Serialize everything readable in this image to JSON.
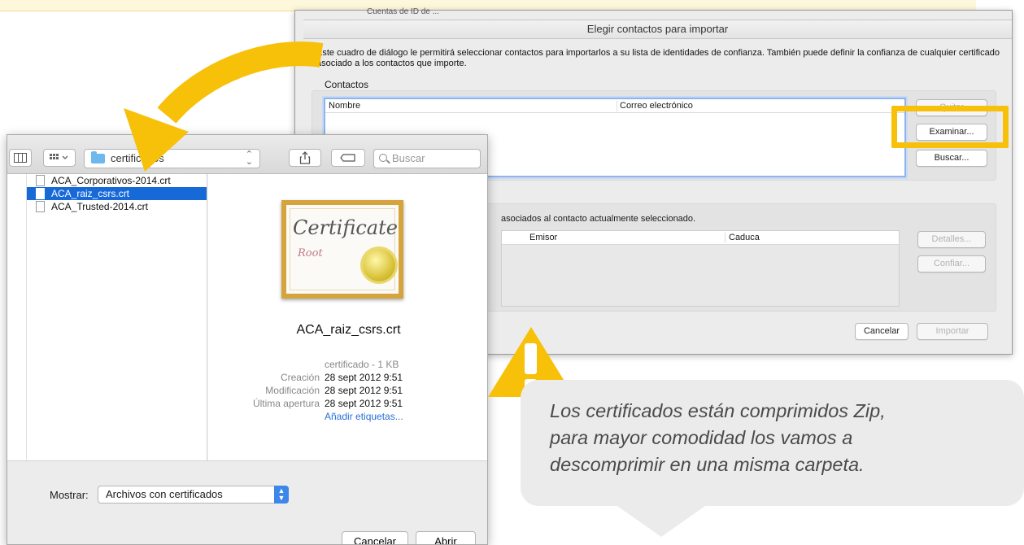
{
  "back_dialog": {
    "peek_text": "Cuentas de ID de ...",
    "title": "Elegir contactos para importar",
    "description": "Este cuadro de diálogo le permitirá seleccionar contactos para importarlos a su lista de identidades de confianza. También puede definir la confianza de cualquier certificado asociado a los contactos que importe.",
    "group_label": "Contactos",
    "columns": [
      "Nombre",
      "Correo electrónico"
    ],
    "buttons": {
      "top_hidden": "Quitar",
      "examine": "Examinar...",
      "search": "Buscar...",
      "details": "Detalles...",
      "trust": "Confiar...",
      "cancel": "Cancelar",
      "import": "Importar"
    },
    "certificates_text": "Certificados asociados al contacto actualmente seleccionado.",
    "certificates_text_visible": "asociados al contacto actualmente seleccionado.",
    "cert_columns": [
      "Emisor",
      "Caduca"
    ]
  },
  "open_panel": {
    "folder": "certificados",
    "search_placeholder": "Buscar",
    "files": [
      {
        "name": "ACA_Corporativos-2014.crt",
        "selected": false
      },
      {
        "name": "ACA_raiz_csrs.crt",
        "selected": true
      },
      {
        "name": "ACA_Trusted-2014.crt",
        "selected": false
      }
    ],
    "preview": {
      "icon_script": "Certificate",
      "icon_root": "Root",
      "name": "ACA_raiz_csrs.crt",
      "kind": "certificado - 1 KB",
      "created_label": "Creación",
      "created": "28 sept 2012 9:51",
      "modified_label": "Modificación",
      "modified": "28 sept 2012 9:51",
      "opened_label": "Última apertura",
      "opened": "28 sept 2012 9:51",
      "tags_link": "Añadir etiquetas..."
    },
    "show_label": "Mostrar:",
    "show_value": "Archivos con certificados",
    "cancel": "Cancelar",
    "open": "Abrir"
  },
  "annotation": {
    "text": "Los certificados  están comprimidos Zip,\npara mayor comodidad los vamos a\ndescomprimir en una misma carpeta.",
    "accent_color": "#f7c009",
    "bubble_color": "#ebebeb"
  },
  "icons": [
    "column-view-icon",
    "grid-view-icon",
    "folder-icon",
    "share-icon",
    "tag-icon",
    "search-icon",
    "file-icon",
    "certificate-icon",
    "warning-icon",
    "curved-arrow-icon"
  ]
}
